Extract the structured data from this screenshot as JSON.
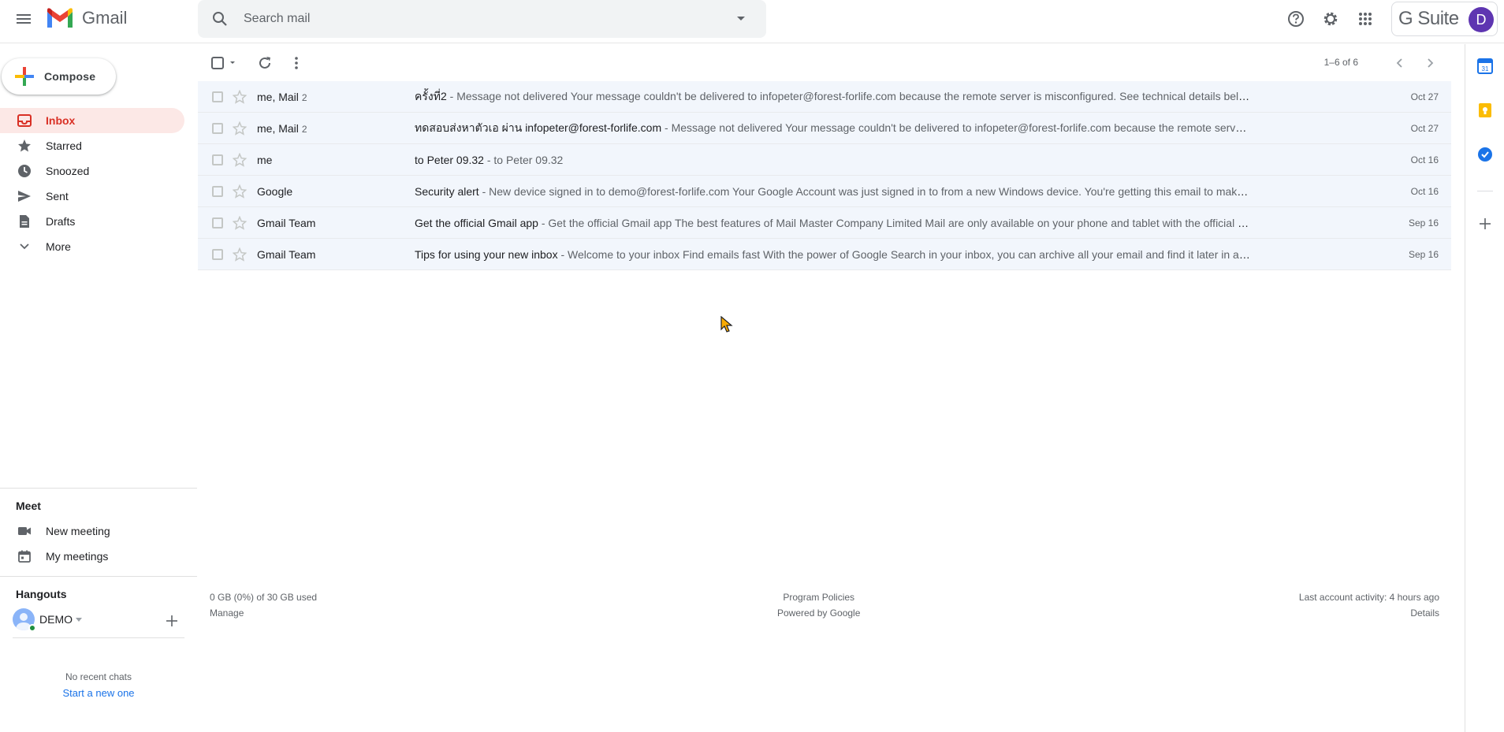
{
  "app": {
    "name": "Gmail"
  },
  "search": {
    "placeholder": "Search mail"
  },
  "header": {
    "brand": "G Suite",
    "avatar_letter": "D",
    "avatar_color": "#5e35b1"
  },
  "compose": {
    "label": "Compose"
  },
  "nav": {
    "items": [
      {
        "label": "Inbox",
        "icon": "inbox-icon"
      },
      {
        "label": "Starred",
        "icon": "star-icon"
      },
      {
        "label": "Snoozed",
        "icon": "clock-icon"
      },
      {
        "label": "Sent",
        "icon": "send-icon"
      },
      {
        "label": "Drafts",
        "icon": "draft-icon"
      },
      {
        "label": "More",
        "icon": "chevron-down-icon"
      }
    ]
  },
  "meet": {
    "title": "Meet",
    "new_meeting": "New meeting",
    "my_meetings": "My meetings"
  },
  "hangouts": {
    "title": "Hangouts",
    "user": "DEMO",
    "no_chats": "No recent chats",
    "start_new": "Start a new one"
  },
  "toolbar": {
    "pager": "1–6 of 6"
  },
  "emails": [
    {
      "sender": "me, Mail",
      "count": "2",
      "subject": "ครั้งที่2",
      "snippet": " - Message not delivered Your message couldn't be delivered to infopeter@forest-forlife.com because the remote server is misconfigured. See technical details below",
      "date": "Oct 27"
    },
    {
      "sender": "me, Mail",
      "count": "2",
      "subject": "ทดสอบส่งหาตัวเอ ผ่าน infopeter@forest-forlife.com",
      "snippet": " - Message not delivered Your message couldn't be delivered to infopeter@forest-forlife.com because the remote server is misconfigured...",
      "date": "Oct 27"
    },
    {
      "sender": "me",
      "count": "",
      "subject": "to Peter 09.32",
      "snippet": " - to Peter 09.32",
      "date": "Oct 16"
    },
    {
      "sender": "Google",
      "count": "",
      "subject": "Security alert",
      "snippet": " - New device signed in to demo@forest-forlife.com Your Google Account was just signed in to from a new Windows device. You're getting this email to make sure it w",
      "date": "Oct 16"
    },
    {
      "sender": "Gmail Team",
      "count": "",
      "subject": "Get the official Gmail app",
      "snippet": " - Get the official Gmail app The best features of Mail Master Company Limited Mail are only available on your phone and tablet with the official Gmail app. Downlo",
      "date": "Sep 16"
    },
    {
      "sender": "Gmail Team",
      "count": "",
      "subject": "Tips for using your new inbox",
      "snippet": " - Welcome to your inbox Find emails fast With the power of Google Search in your inbox, you can archive all your email and find it later in a flash. Your inbox st",
      "date": "Sep 16"
    }
  ],
  "footer": {
    "storage": "0 GB (0%) of 30 GB used",
    "manage": "Manage",
    "policies": "Program Policies",
    "powered": "Powered by Google",
    "activity": "Last account activity: 4 hours ago",
    "details": "Details"
  }
}
